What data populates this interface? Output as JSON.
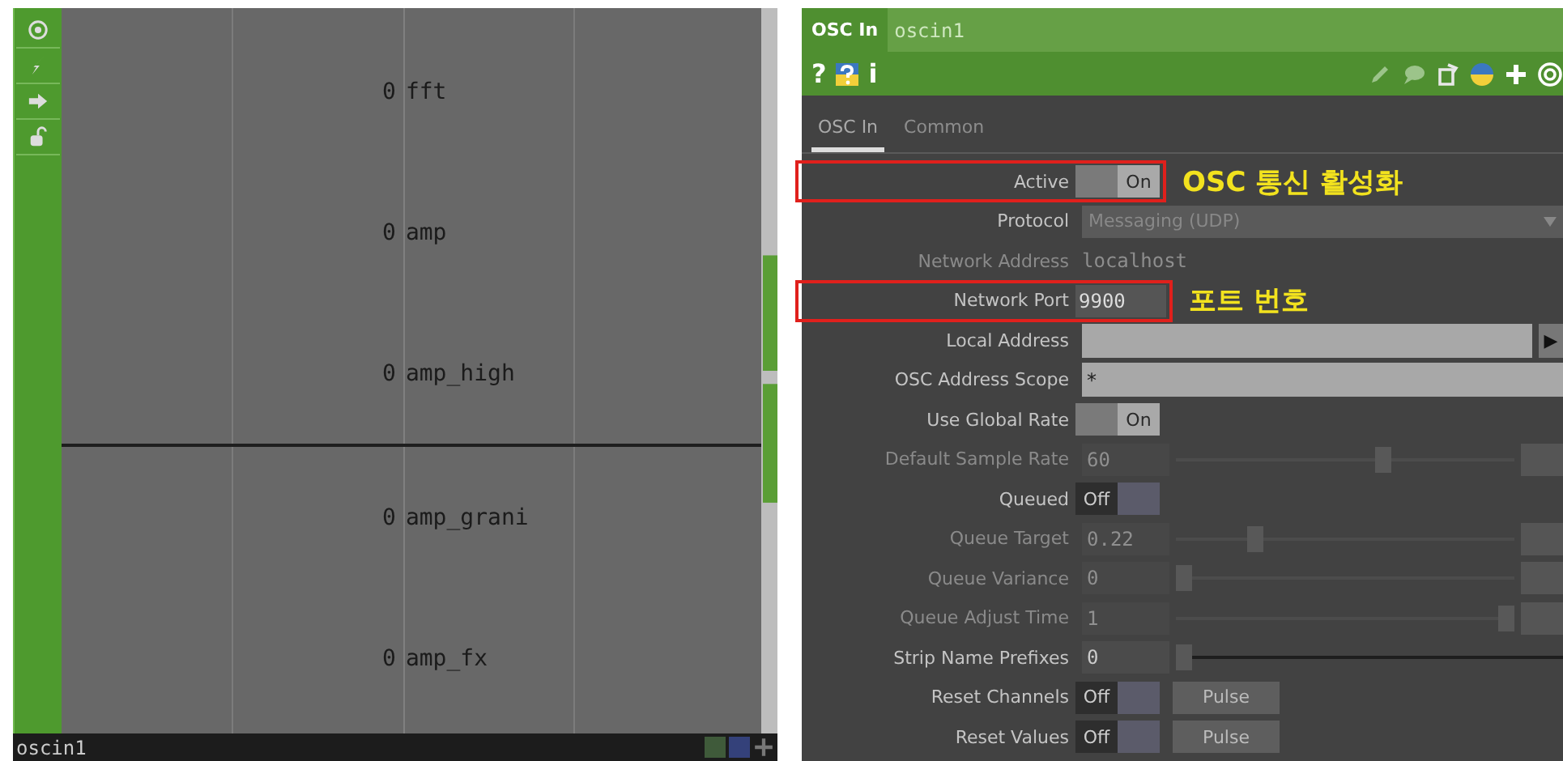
{
  "viewer": {
    "channels": [
      {
        "value": "0",
        "name": "fft",
        "divider_below": false
      },
      {
        "value": "0",
        "name": "amp",
        "divider_below": false
      },
      {
        "value": "0",
        "name": "amp_high",
        "divider_below": true
      },
      {
        "value": "0",
        "name": "amp_grani",
        "divider_below": false
      },
      {
        "value": "0",
        "name": "amp_fx",
        "divider_below": false
      }
    ],
    "status_bar": {
      "name": "oscin1"
    }
  },
  "parameters_panel": {
    "type_label": "OSC In",
    "node_name": "oscin1",
    "help_glyph": "?",
    "info_glyph": "i",
    "tabs": [
      {
        "label": "OSC In",
        "selected": true
      },
      {
        "label": "Common",
        "selected": false
      }
    ],
    "rows": [
      {
        "kind": "toggle",
        "label": "Active",
        "on": true,
        "value": "On",
        "disabled": false,
        "highlighted": true,
        "annotation": "OSC 통신 활성화"
      },
      {
        "kind": "menu",
        "label": "Protocol",
        "value": "Messaging (UDP)",
        "disabled": false,
        "highlighted": false
      },
      {
        "kind": "text",
        "label": "Network Address",
        "value": "localhost",
        "disabled": true,
        "highlighted": false
      },
      {
        "kind": "field",
        "label": "Network Port",
        "value": "9900",
        "disabled": false,
        "highlighted": true,
        "annotation": "포트 번호"
      },
      {
        "kind": "wide",
        "label": "Local Address",
        "value": "",
        "disabled": false,
        "highlighted": false,
        "arrow": "▶"
      },
      {
        "kind": "wide",
        "label": "OSC Address Scope",
        "value": "*",
        "disabled": false,
        "highlighted": false
      },
      {
        "kind": "toggle",
        "label": "Use Global Rate",
        "on": true,
        "value": "On",
        "disabled": false,
        "highlighted": false
      },
      {
        "kind": "slider",
        "label": "Default Sample Rate",
        "value": "60",
        "level": 0.62,
        "disabled": true,
        "highlighted": false
      },
      {
        "kind": "toggle",
        "label": "Queued",
        "on": false,
        "value": "Off",
        "disabled": false,
        "highlighted": false
      },
      {
        "kind": "slider",
        "label": "Queue Target",
        "value": "0.22",
        "level": 0.22,
        "disabled": true,
        "highlighted": false
      },
      {
        "kind": "slider",
        "label": "Queue Variance",
        "value": "0",
        "level": 0,
        "disabled": true,
        "highlighted": false
      },
      {
        "kind": "slider",
        "label": "Queue Adjust Time",
        "value": "1",
        "level": 1,
        "disabled": true,
        "highlighted": false
      },
      {
        "kind": "slider",
        "label": "Strip Name Prefixes",
        "value": "0",
        "level": 0,
        "disabled": false,
        "highlighted": false
      },
      {
        "kind": "toggle_pulse",
        "label": "Reset Channels",
        "on": false,
        "value": "Off",
        "pulse": "Pulse",
        "disabled": false,
        "highlighted": false
      },
      {
        "kind": "toggle_pulse",
        "label": "Reset Values",
        "on": false,
        "value": "Off",
        "pulse": "Pulse",
        "disabled": false,
        "highlighted": false
      }
    ]
  }
}
